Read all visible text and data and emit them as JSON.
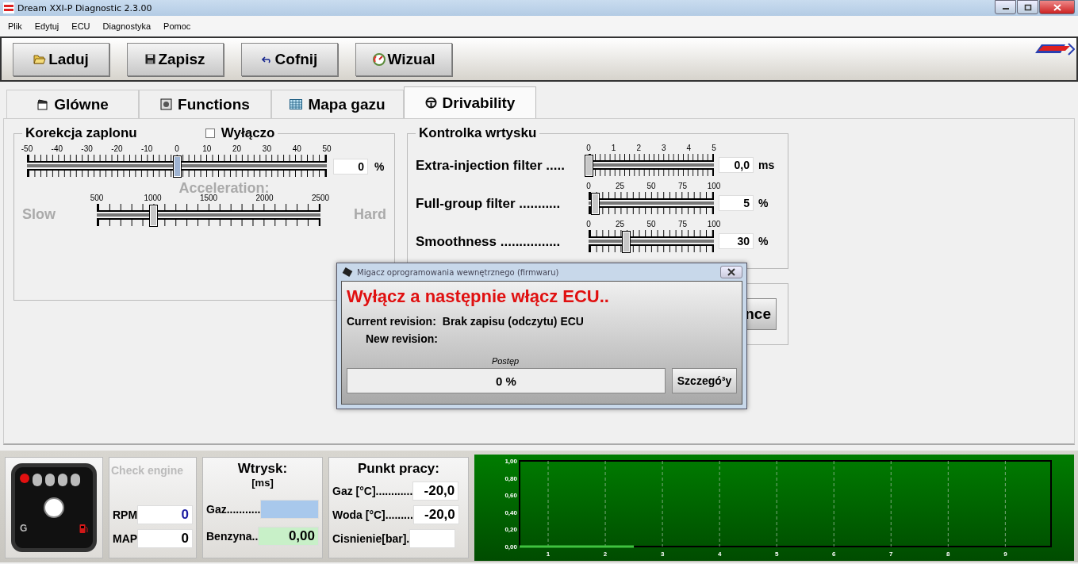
{
  "window": {
    "title": "Dream XXI-P Diagnostic 2.3.00"
  },
  "menu": [
    "Plik",
    "Edytuj",
    "ECU",
    "Diagnostyka",
    "Pomoc"
  ],
  "toolbar": [
    {
      "label": "Laduj",
      "kind": "folder"
    },
    {
      "label": "Zapisz",
      "kind": "save"
    },
    {
      "label": "Cofnij",
      "kind": "undo"
    },
    {
      "label": "Wizual",
      "kind": "gauge"
    }
  ],
  "tabs": [
    {
      "label": "Glówne",
      "kind": "clapper",
      "selected": false
    },
    {
      "label": "Functions",
      "kind": "chip",
      "selected": false
    },
    {
      "label": "Mapa gazu",
      "kind": "table",
      "selected": false
    },
    {
      "label": "Drivability",
      "kind": "wheel",
      "selected": true
    }
  ],
  "ignition": {
    "title": "Korekcja zaplonu",
    "disable": {
      "label": "Wyłączo",
      "checked": false
    },
    "slider": {
      "ticks": [
        "-50",
        "-40",
        "-30",
        "-20",
        "-10",
        "0",
        "10",
        "20",
        "30",
        "40",
        "50"
      ],
      "level": 0.5
    },
    "value": "0",
    "unit": "%",
    "acceleration": {
      "title": "Acceleration:",
      "left": "Slow",
      "right": "Hard",
      "ticks": [
        "500",
        "1000",
        "1500",
        "2000",
        "2500"
      ],
      "level": 0.25,
      "disabled": true
    }
  },
  "injection_control": {
    "title": "Kontrolka wrtysku",
    "rows": [
      {
        "label": "Extra-injection filter .....",
        "ticks": [
          "0",
          "1",
          "2",
          "3",
          "4",
          "5"
        ],
        "level": 0,
        "value": "0,0",
        "unit": "ms"
      },
      {
        "label": "Full-group filter ...........",
        "ticks": [
          "0",
          "25",
          "50",
          "75",
          "100"
        ],
        "level": 0.05,
        "value": "5",
        "unit": "%"
      },
      {
        "label": "Smoothness ................",
        "ticks": [
          "0",
          "25",
          "50",
          "75",
          "100"
        ],
        "level": 0.3,
        "value": "30",
        "unit": "%"
      }
    ]
  },
  "extra_panel": {
    "button": "nce"
  },
  "dialog": {
    "title": "Migacz oprogramowania wewnętrznego (firmwaru)",
    "heading": "Wyłącz a następnie włącz ECU..",
    "current_label": "Current revision:",
    "current_value": "Brak zapisu (odczytu) ECU",
    "new_label": "New revision:",
    "progress_label": "Postęp",
    "progress": {
      "level": 0,
      "text": "0 %"
    },
    "details_button": "Szczegó³y"
  },
  "status": {
    "indicator": {
      "label": "G",
      "leds": [
        {
          "on": true
        },
        {
          "on": false
        },
        {
          "on": false
        },
        {
          "on": false
        },
        {
          "on": false
        }
      ]
    },
    "check_engine": {
      "label": "Check engine",
      "on": false
    },
    "rpm": {
      "label": "RPM",
      "value": "0"
    },
    "map": {
      "label": "MAP",
      "value": "0"
    },
    "injection": {
      "title": "Wtrysk:",
      "unit": "[ms]",
      "rows": [
        {
          "label": "Gaz...........",
          "kind": "gas"
        },
        {
          "label": "Benzyna..",
          "kind": "petrol",
          "value": "0,00"
        }
      ]
    },
    "operating_point": {
      "title": "Punkt pracy:",
      "rows": [
        {
          "label": "Gaz [°C]............",
          "value": "-20,0"
        },
        {
          "label": "Woda [°C].........",
          "value": "-20,0"
        },
        {
          "label": "Cisnienie[bar]."
        }
      ]
    }
  },
  "graph": {
    "chart_data": {
      "type": "line",
      "x": [
        0.5,
        2.5
      ],
      "series": [
        {
          "color": "#3fc23f",
          "values": [
            0,
            0
          ]
        }
      ],
      "grid": true,
      "xlim": [
        0.5,
        9.8
      ],
      "ylim": [
        0,
        1
      ],
      "xticks": [
        1,
        2,
        3,
        4,
        5,
        6,
        7,
        8,
        9
      ],
      "yticks": [
        {
          "value": 0,
          "label": "0,00"
        },
        {
          "value": 0.2,
          "label": "0,20"
        },
        {
          "value": 0.4,
          "label": "0,40"
        },
        {
          "value": 0.6,
          "label": "0,60"
        },
        {
          "value": 0.8,
          "label": "0,80"
        },
        {
          "value": 1,
          "label": "1,00"
        }
      ]
    }
  }
}
